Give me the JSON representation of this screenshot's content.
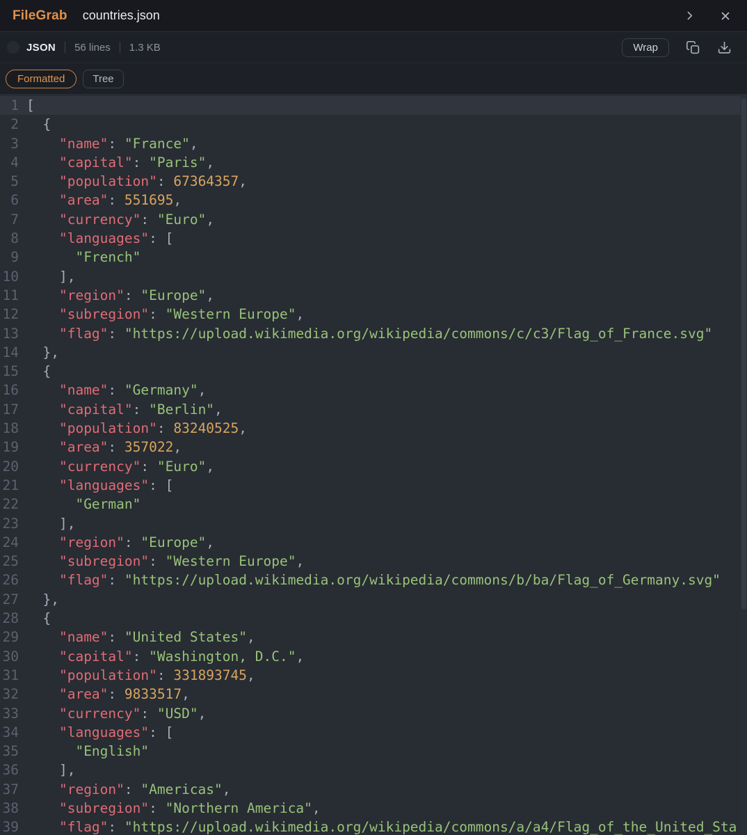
{
  "titlebar": {
    "app_name": "FileGrab",
    "file_name": "countries.json"
  },
  "toolbar": {
    "file_type": "JSON",
    "line_count": "56 lines",
    "file_size": "1.3 KB",
    "wrap_label": "Wrap"
  },
  "tabs": {
    "formatted": "Formatted",
    "tree": "Tree",
    "active": "Formatted"
  },
  "colors": {
    "accent_orange": "#e0954f",
    "key": "#e06c75",
    "string": "#98c379",
    "number": "#d8a65f",
    "punctuation": "#a6adbb",
    "line_number": "#5b6270",
    "code_background": "#282c33",
    "highlighted_line_background": "#30353e",
    "header_background": "#17191e",
    "bar_background": "#1d2127"
  },
  "code": {
    "highlighted_line": 1,
    "lines": [
      {
        "n": 1,
        "t": [
          [
            "p",
            "["
          ]
        ]
      },
      {
        "n": 2,
        "t": [
          [
            "p",
            "  {"
          ]
        ]
      },
      {
        "n": 3,
        "t": [
          [
            "p",
            "    "
          ],
          [
            "k",
            "\"name\""
          ],
          [
            "p",
            ": "
          ],
          [
            "s",
            "\"France\""
          ],
          [
            "p",
            ","
          ]
        ]
      },
      {
        "n": 4,
        "t": [
          [
            "p",
            "    "
          ],
          [
            "k",
            "\"capital\""
          ],
          [
            "p",
            ": "
          ],
          [
            "s",
            "\"Paris\""
          ],
          [
            "p",
            ","
          ]
        ]
      },
      {
        "n": 5,
        "t": [
          [
            "p",
            "    "
          ],
          [
            "k",
            "\"population\""
          ],
          [
            "p",
            ": "
          ],
          [
            "n",
            "67364357"
          ],
          [
            "p",
            ","
          ]
        ]
      },
      {
        "n": 6,
        "t": [
          [
            "p",
            "    "
          ],
          [
            "k",
            "\"area\""
          ],
          [
            "p",
            ": "
          ],
          [
            "n",
            "551695"
          ],
          [
            "p",
            ","
          ]
        ]
      },
      {
        "n": 7,
        "t": [
          [
            "p",
            "    "
          ],
          [
            "k",
            "\"currency\""
          ],
          [
            "p",
            ": "
          ],
          [
            "s",
            "\"Euro\""
          ],
          [
            "p",
            ","
          ]
        ]
      },
      {
        "n": 8,
        "t": [
          [
            "p",
            "    "
          ],
          [
            "k",
            "\"languages\""
          ],
          [
            "p",
            ": ["
          ]
        ]
      },
      {
        "n": 9,
        "t": [
          [
            "p",
            "      "
          ],
          [
            "s",
            "\"French\""
          ]
        ]
      },
      {
        "n": 10,
        "t": [
          [
            "p",
            "    ],"
          ]
        ]
      },
      {
        "n": 11,
        "t": [
          [
            "p",
            "    "
          ],
          [
            "k",
            "\"region\""
          ],
          [
            "p",
            ": "
          ],
          [
            "s",
            "\"Europe\""
          ],
          [
            "p",
            ","
          ]
        ]
      },
      {
        "n": 12,
        "t": [
          [
            "p",
            "    "
          ],
          [
            "k",
            "\"subregion\""
          ],
          [
            "p",
            ": "
          ],
          [
            "s",
            "\"Western Europe\""
          ],
          [
            "p",
            ","
          ]
        ]
      },
      {
        "n": 13,
        "t": [
          [
            "p",
            "    "
          ],
          [
            "k",
            "\"flag\""
          ],
          [
            "p",
            ": "
          ],
          [
            "s",
            "\"https://upload.wikimedia.org/wikipedia/commons/c/c3/Flag_of_France.svg\""
          ]
        ]
      },
      {
        "n": 14,
        "t": [
          [
            "p",
            "  },"
          ]
        ]
      },
      {
        "n": 15,
        "t": [
          [
            "p",
            "  {"
          ]
        ]
      },
      {
        "n": 16,
        "t": [
          [
            "p",
            "    "
          ],
          [
            "k",
            "\"name\""
          ],
          [
            "p",
            ": "
          ],
          [
            "s",
            "\"Germany\""
          ],
          [
            "p",
            ","
          ]
        ]
      },
      {
        "n": 17,
        "t": [
          [
            "p",
            "    "
          ],
          [
            "k",
            "\"capital\""
          ],
          [
            "p",
            ": "
          ],
          [
            "s",
            "\"Berlin\""
          ],
          [
            "p",
            ","
          ]
        ]
      },
      {
        "n": 18,
        "t": [
          [
            "p",
            "    "
          ],
          [
            "k",
            "\"population\""
          ],
          [
            "p",
            ": "
          ],
          [
            "n",
            "83240525"
          ],
          [
            "p",
            ","
          ]
        ]
      },
      {
        "n": 19,
        "t": [
          [
            "p",
            "    "
          ],
          [
            "k",
            "\"area\""
          ],
          [
            "p",
            ": "
          ],
          [
            "n",
            "357022"
          ],
          [
            "p",
            ","
          ]
        ]
      },
      {
        "n": 20,
        "t": [
          [
            "p",
            "    "
          ],
          [
            "k",
            "\"currency\""
          ],
          [
            "p",
            ": "
          ],
          [
            "s",
            "\"Euro\""
          ],
          [
            "p",
            ","
          ]
        ]
      },
      {
        "n": 21,
        "t": [
          [
            "p",
            "    "
          ],
          [
            "k",
            "\"languages\""
          ],
          [
            "p",
            ": ["
          ]
        ]
      },
      {
        "n": 22,
        "t": [
          [
            "p",
            "      "
          ],
          [
            "s",
            "\"German\""
          ]
        ]
      },
      {
        "n": 23,
        "t": [
          [
            "p",
            "    ],"
          ]
        ]
      },
      {
        "n": 24,
        "t": [
          [
            "p",
            "    "
          ],
          [
            "k",
            "\"region\""
          ],
          [
            "p",
            ": "
          ],
          [
            "s",
            "\"Europe\""
          ],
          [
            "p",
            ","
          ]
        ]
      },
      {
        "n": 25,
        "t": [
          [
            "p",
            "    "
          ],
          [
            "k",
            "\"subregion\""
          ],
          [
            "p",
            ": "
          ],
          [
            "s",
            "\"Western Europe\""
          ],
          [
            "p",
            ","
          ]
        ]
      },
      {
        "n": 26,
        "t": [
          [
            "p",
            "    "
          ],
          [
            "k",
            "\"flag\""
          ],
          [
            "p",
            ": "
          ],
          [
            "s",
            "\"https://upload.wikimedia.org/wikipedia/commons/b/ba/Flag_of_Germany.svg\""
          ]
        ]
      },
      {
        "n": 27,
        "t": [
          [
            "p",
            "  },"
          ]
        ]
      },
      {
        "n": 28,
        "t": [
          [
            "p",
            "  {"
          ]
        ]
      },
      {
        "n": 29,
        "t": [
          [
            "p",
            "    "
          ],
          [
            "k",
            "\"name\""
          ],
          [
            "p",
            ": "
          ],
          [
            "s",
            "\"United States\""
          ],
          [
            "p",
            ","
          ]
        ]
      },
      {
        "n": 30,
        "t": [
          [
            "p",
            "    "
          ],
          [
            "k",
            "\"capital\""
          ],
          [
            "p",
            ": "
          ],
          [
            "s",
            "\"Washington, D.C.\""
          ],
          [
            "p",
            ","
          ]
        ]
      },
      {
        "n": 31,
        "t": [
          [
            "p",
            "    "
          ],
          [
            "k",
            "\"population\""
          ],
          [
            "p",
            ": "
          ],
          [
            "n",
            "331893745"
          ],
          [
            "p",
            ","
          ]
        ]
      },
      {
        "n": 32,
        "t": [
          [
            "p",
            "    "
          ],
          [
            "k",
            "\"area\""
          ],
          [
            "p",
            ": "
          ],
          [
            "n",
            "9833517"
          ],
          [
            "p",
            ","
          ]
        ]
      },
      {
        "n": 33,
        "t": [
          [
            "p",
            "    "
          ],
          [
            "k",
            "\"currency\""
          ],
          [
            "p",
            ": "
          ],
          [
            "s",
            "\"USD\""
          ],
          [
            "p",
            ","
          ]
        ]
      },
      {
        "n": 34,
        "t": [
          [
            "p",
            "    "
          ],
          [
            "k",
            "\"languages\""
          ],
          [
            "p",
            ": ["
          ]
        ]
      },
      {
        "n": 35,
        "t": [
          [
            "p",
            "      "
          ],
          [
            "s",
            "\"English\""
          ]
        ]
      },
      {
        "n": 36,
        "t": [
          [
            "p",
            "    ],"
          ]
        ]
      },
      {
        "n": 37,
        "t": [
          [
            "p",
            "    "
          ],
          [
            "k",
            "\"region\""
          ],
          [
            "p",
            ": "
          ],
          [
            "s",
            "\"Americas\""
          ],
          [
            "p",
            ","
          ]
        ]
      },
      {
        "n": 38,
        "t": [
          [
            "p",
            "    "
          ],
          [
            "k",
            "\"subregion\""
          ],
          [
            "p",
            ": "
          ],
          [
            "s",
            "\"Northern America\""
          ],
          [
            "p",
            ","
          ]
        ]
      },
      {
        "n": 39,
        "t": [
          [
            "p",
            "    "
          ],
          [
            "k",
            "\"flag\""
          ],
          [
            "p",
            ": "
          ],
          [
            "s",
            "\"https://upload.wikimedia.org/wikipedia/commons/a/a4/Flag_of_the_United_Sta"
          ]
        ]
      }
    ]
  }
}
